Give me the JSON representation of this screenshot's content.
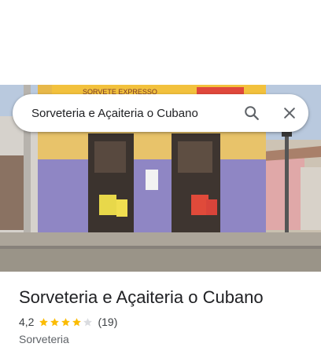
{
  "search": {
    "query": "Sorveteria e Açaiteria o Cubano",
    "search_icon": "search-icon",
    "close_icon": "close-icon"
  },
  "photo": {
    "sign_text": "SORVETE EXPRESSO"
  },
  "place": {
    "name": "Sorveteria e Açaiteria o Cubano",
    "rating": "4,2",
    "rating_value": 4.2,
    "stars_max": 5,
    "reviews": "(19)",
    "category": "Sorveteria"
  },
  "colors": {
    "star_filled": "#fbbc04",
    "star_empty": "#dadce0",
    "text_primary": "#202124",
    "text_secondary": "#5f6368"
  }
}
